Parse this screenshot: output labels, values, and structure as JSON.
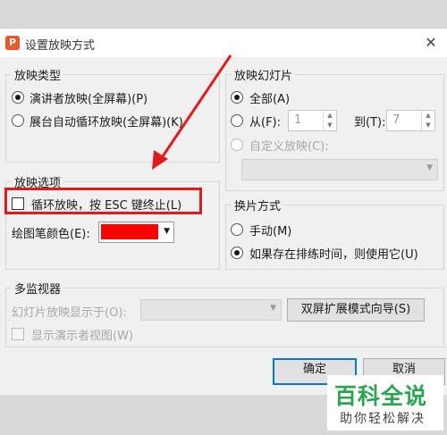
{
  "window": {
    "title": "设置放映方式",
    "app_icon": "P"
  },
  "show_type": {
    "legend": "放映类型",
    "options": [
      "演讲者放映(全屏幕)(P)",
      "展台自动循环放映(全屏幕)(K)"
    ],
    "selected": 0
  },
  "slides": {
    "legend": "放映幻灯片",
    "all_label": "全部(A)",
    "from_label": "从(F):",
    "from_value": "1",
    "to_label": "到(T):",
    "to_value": "7",
    "custom_label": "自定义放映(C):"
  },
  "show_options": {
    "legend": "放映选项",
    "loop_label": "循环放映，按 ESC 键终止(L)",
    "loop_checked": false,
    "pen_color_label": "绘图笔颜色(E):",
    "pen_color": "#ff0000"
  },
  "advance": {
    "legend": "换片方式",
    "manual_label": "手动(M)",
    "timing_label": "如果存在排练时间，则使用它(U)",
    "selected": 1
  },
  "monitors": {
    "legend": "多监视器",
    "display_on_label": "幻灯片放映显示于(O):",
    "dual_screen_button": "双屏扩展模式向导(S)",
    "presenter_view_label": "显示演示者视图(W)"
  },
  "buttons": {
    "ok": "确定",
    "cancel": "取消"
  },
  "watermark": {
    "main": "百科全说",
    "sub": "助你轻松解决"
  },
  "colors": {
    "highlight": "#e01b1b",
    "accent": "#0078d7",
    "watermark": "#2da44e"
  }
}
